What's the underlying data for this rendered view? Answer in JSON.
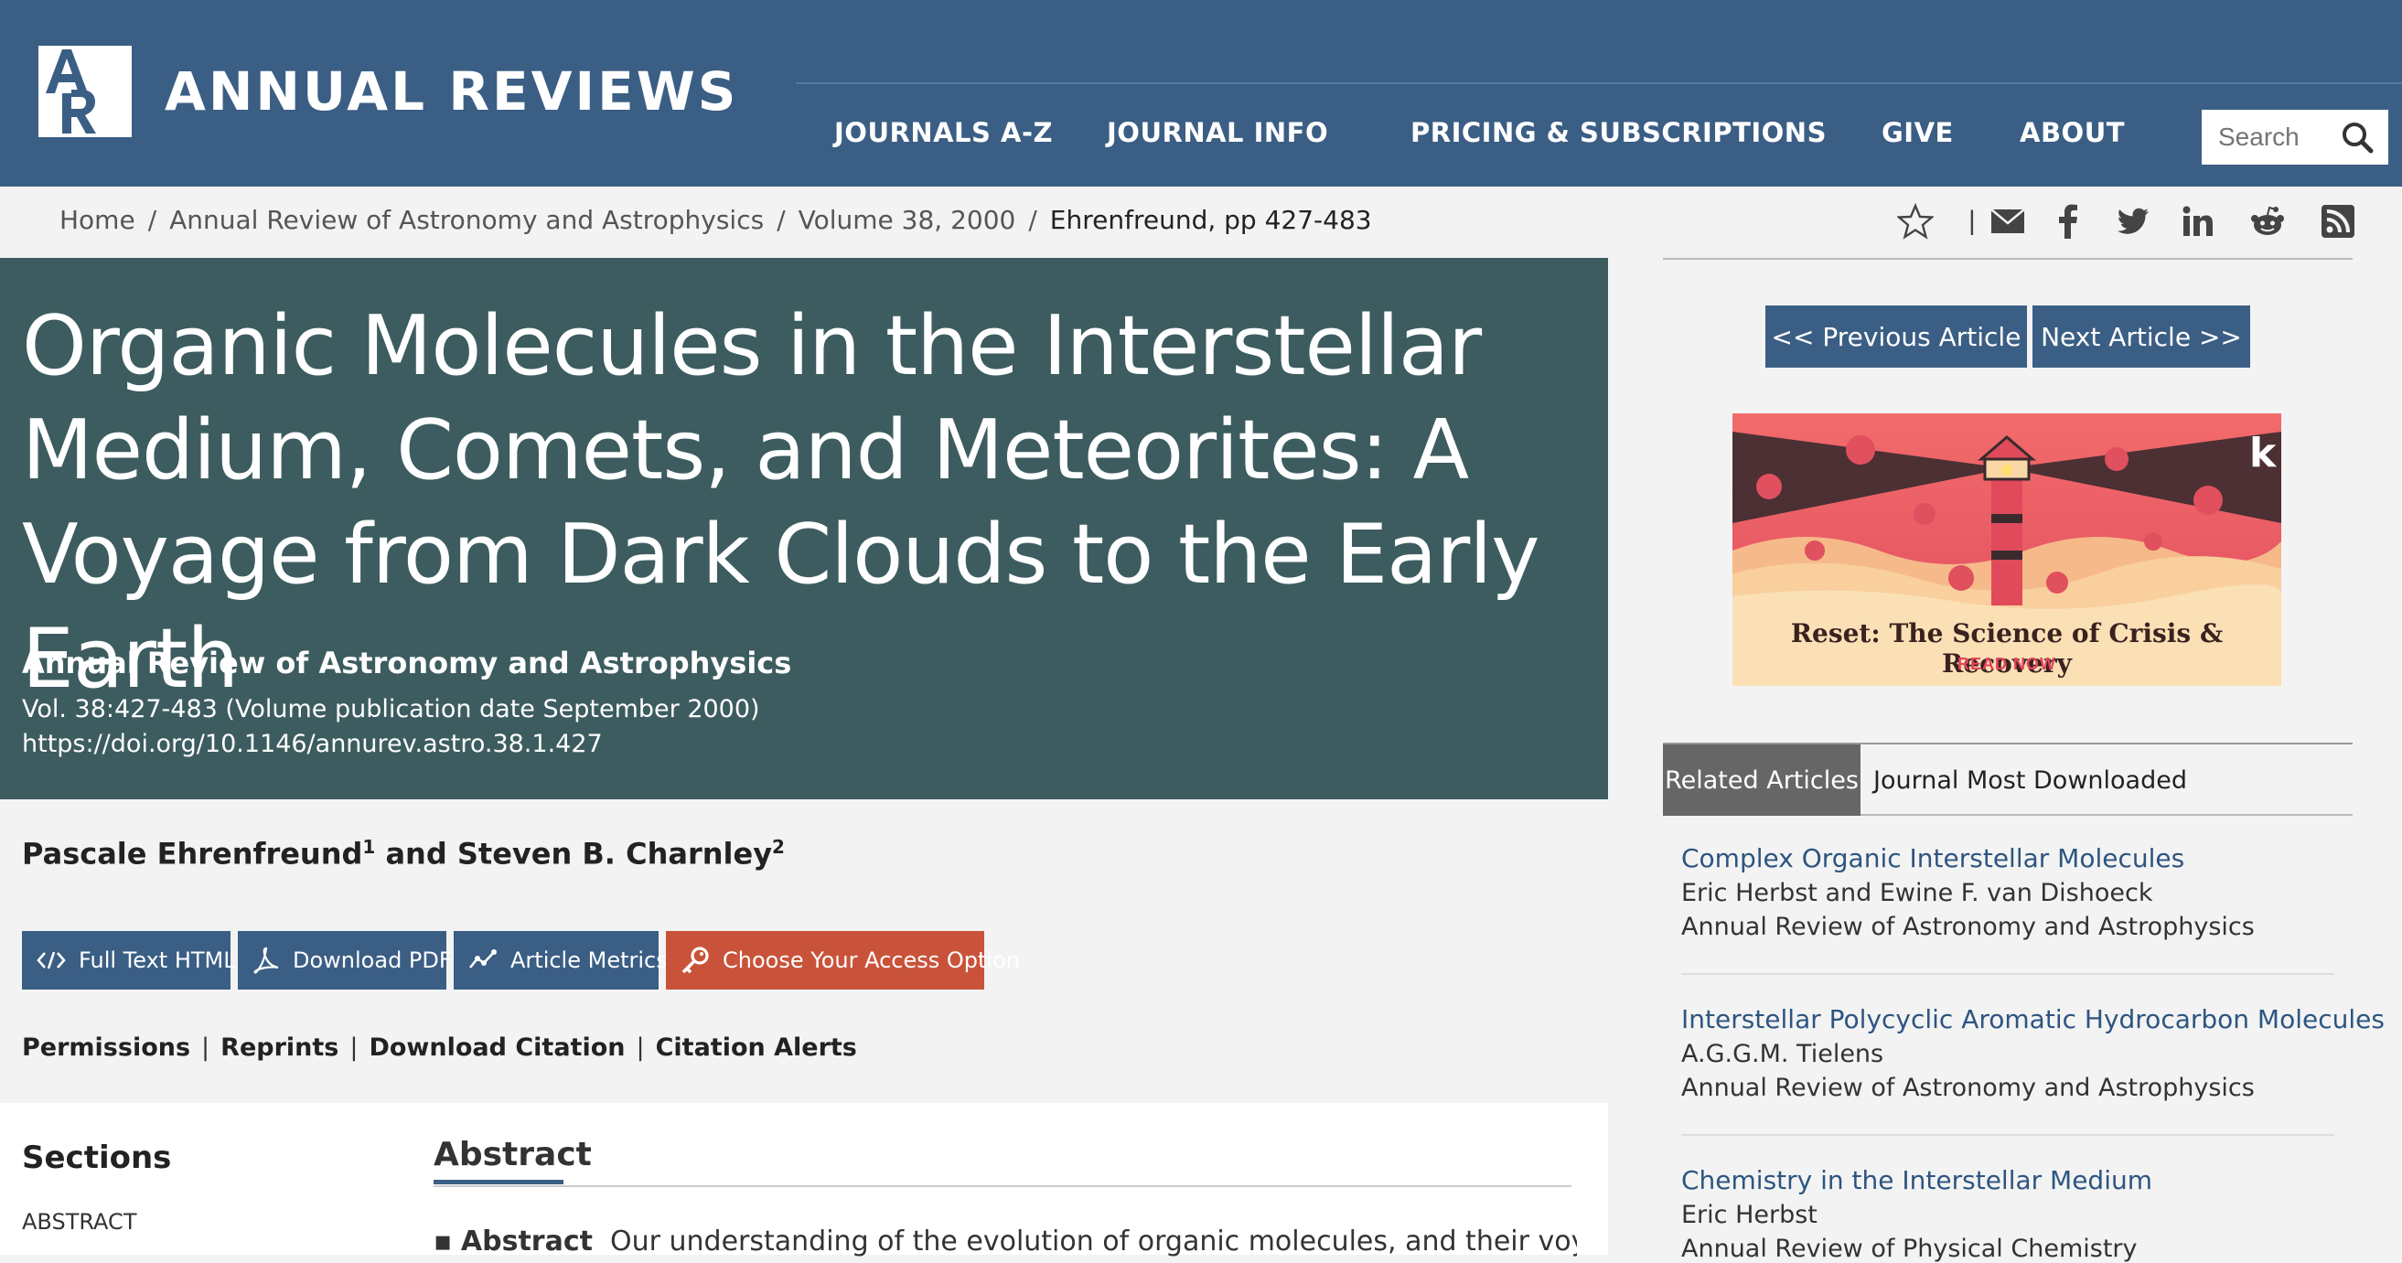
{
  "header": {
    "logo_text": "ANNUAL REVIEWS",
    "logo_mark": "AR",
    "nav": [
      "JOURNALS A-Z",
      "JOURNAL INFO",
      "PRICING & SUBSCRIPTIONS",
      "GIVE",
      "ABOUT"
    ],
    "search_placeholder": "Search"
  },
  "breadcrumb": {
    "items": [
      "Home",
      "Annual Review of Astronomy and Astrophysics",
      "Volume 38, 2000"
    ],
    "current": "Ehrenfreund, pp 427-483",
    "separator": "/"
  },
  "share": {
    "divider": "|",
    "icons": [
      "star-icon",
      "email-icon",
      "facebook-icon",
      "twitter-icon",
      "linkedin-icon",
      "reddit-icon",
      "rss-icon"
    ]
  },
  "article": {
    "title": "Organic Molecules in the Interstellar Medium, Comets, and Meteorites: A Voyage from Dark Clouds to the Early Earth",
    "journal": "Annual Review of Astronomy and Astrophysics",
    "volume_info": "Vol. 38:427-483 (Volume publication date September 2000)",
    "doi": "https://doi.org/10.1146/annurev.astro.38.1.427",
    "author1": "Pascale Ehrenfreund",
    "author1_sup": "1",
    "author_join": " and ",
    "author2": "Steven B. Charnley",
    "author2_sup": "2"
  },
  "buttons": {
    "full_text": "Full Text HTML",
    "pdf": "Download PDF",
    "metrics": "Article Metrics",
    "access": "Choose Your Access Option"
  },
  "links": {
    "permissions": "Permissions",
    "reprints": "Reprints",
    "citation": "Download Citation",
    "alerts": "Citation Alerts",
    "divider": "|"
  },
  "sections": {
    "heading": "Sections",
    "items": [
      "ABSTRACT"
    ]
  },
  "abstract": {
    "heading": "Abstract",
    "bullet": "▪",
    "label": "Abstract",
    "text": "Our understanding of the evolution of organic molecules, and their voyage from"
  },
  "sidebar": {
    "prev": "<< Previous Article",
    "next": "Next Article >>",
    "ad_title": "Reset: The Science of Crisis & Recovery",
    "ad_cta": "READ NOW",
    "ad_logo": "k",
    "tabs": [
      "Related Articles",
      "Journal Most Downloaded"
    ],
    "related": [
      {
        "title": "Complex Organic Interstellar Molecules",
        "authors": "Eric Herbst and Ewine F. van Dishoeck",
        "journal": "Annual Review of Astronomy and Astrophysics"
      },
      {
        "title": "Interstellar Polycyclic Aromatic Hydrocarbon Molecules",
        "authors": "A.G.G.M. Tielens",
        "journal": "Annual Review of Astronomy and Astrophysics"
      },
      {
        "title": "Chemistry in the Interstellar Medium",
        "authors": "Eric Herbst",
        "journal": "Annual Review of Physical Chemistry"
      }
    ]
  },
  "colors": {
    "header_bg": "#3b5e84",
    "title_bg": "#3d5c5f",
    "access_btn": "#c9533a",
    "link_blue": "#2d5580"
  }
}
